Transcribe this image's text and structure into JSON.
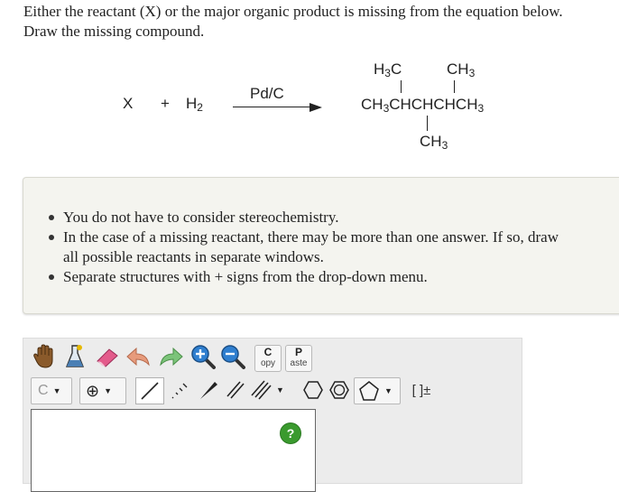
{
  "question": {
    "line1": "Either the reactant (X) or the major organic product is missing from the equation below.",
    "line2": "Draw the missing compound."
  },
  "reaction": {
    "reactant": "X",
    "plus": "+",
    "h2_main": "H",
    "h2_sub": "2",
    "catalyst": "Pd/C",
    "product": {
      "top_left": {
        "main": "H",
        "sub": "3",
        "rest": "C"
      },
      "top_right": {
        "main": "CH",
        "sub": "3"
      },
      "chain": {
        "p1": "CH",
        "s1": "3",
        "p2": "CHCHCHCH",
        "s2": "3"
      },
      "bottom": {
        "main": "CH",
        "sub": "3"
      }
    }
  },
  "instructions": {
    "items": [
      "You do not have to consider stereochemistry.",
      "In the case of a missing reactant, there may be more than one answer. If so, draw",
      "all possible reactants in separate windows.",
      "Separate structures with + signs from the drop-down menu."
    ]
  },
  "editor": {
    "copy_big": "C",
    "copy_small": "opy",
    "paste_big": "P",
    "paste_small": "aste",
    "atom_label": "C",
    "charge_symbol": "⊕",
    "bracket_label": "[ ]±",
    "help_label": "?",
    "icons": [
      "hand-icon",
      "erlenmeyer-icon",
      "eraser-icon",
      "undo-icon",
      "redo-icon",
      "zoom-in-icon",
      "zoom-out-icon"
    ],
    "colors": {
      "help_green": "#3a9a2e",
      "eraser_pink": "#e35b8b",
      "undo_salmon": "#e79b7c",
      "redo_green": "#7cc47a"
    }
  }
}
